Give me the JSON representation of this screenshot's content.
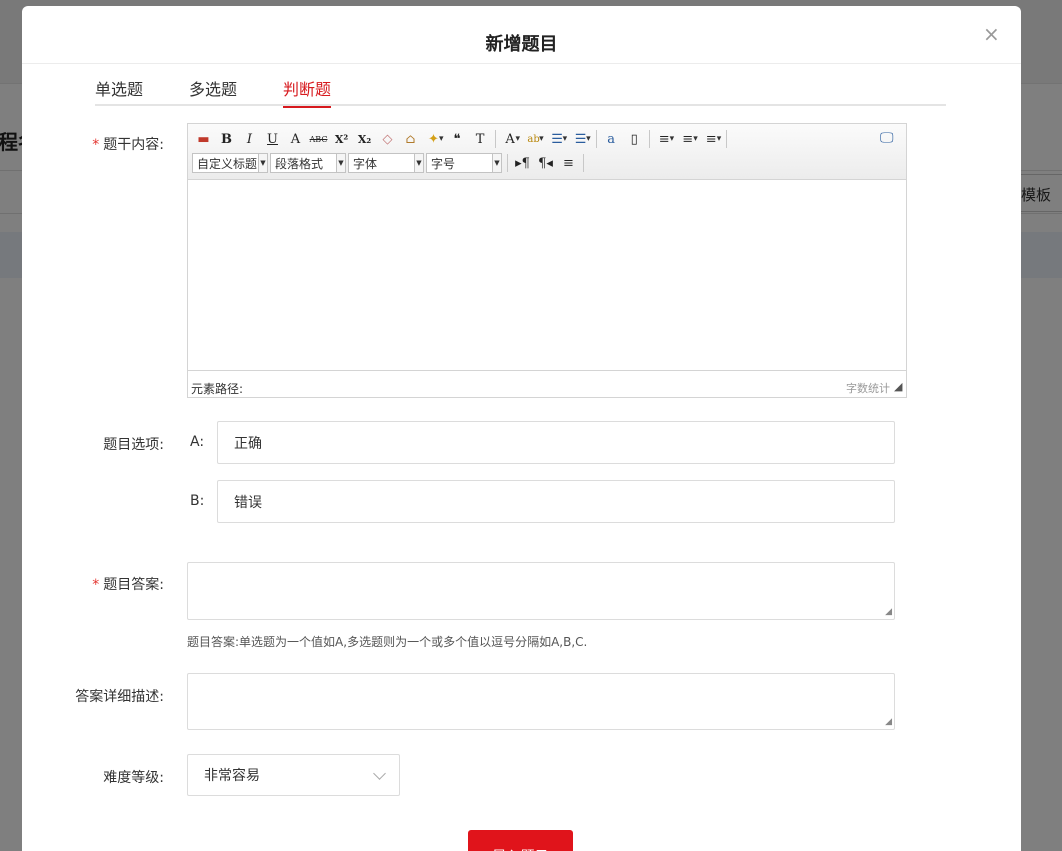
{
  "background": {
    "left_title": "程名",
    "right_button": "模板"
  },
  "modal": {
    "title": "新增题目",
    "close_label": "×"
  },
  "tabs": [
    {
      "label": "单选题",
      "active": false
    },
    {
      "label": "多选题",
      "active": false
    },
    {
      "label": "判断题",
      "active": true
    }
  ],
  "form": {
    "content_label": "题干内容:",
    "options_label": "题目选项:",
    "answer_label": "题目答案:",
    "answer_detail_label": "答案详细描述:",
    "difficulty_label": "难度等级:",
    "required_mark": "*",
    "options": [
      {
        "letter": "A:",
        "value": "正确"
      },
      {
        "letter": "B:",
        "value": "错误"
      }
    ],
    "answer_value": "",
    "answer_hint": "题目答案:单选题为一个值如A,多选题则为一个或多个值以逗号分隔如A,B,C.",
    "answer_detail_value": "",
    "difficulty_selected": "非常容易",
    "import_button": "导入题目"
  },
  "editor": {
    "toolbar_row1": [
      {
        "icon": "image-icon",
        "glyph": "▬"
      },
      {
        "icon": "bold-icon",
        "glyph": "B"
      },
      {
        "icon": "italic-icon",
        "glyph": "I"
      },
      {
        "icon": "underline-icon",
        "glyph": "U"
      },
      {
        "icon": "font-border-icon",
        "glyph": "A"
      },
      {
        "icon": "strikethrough-icon",
        "glyph": "ABC"
      },
      {
        "icon": "superscript-icon",
        "glyph": "X²"
      },
      {
        "icon": "subscript-icon",
        "glyph": "X₂"
      },
      {
        "icon": "eraser-icon",
        "glyph": "◇"
      },
      {
        "icon": "format-brush-icon",
        "glyph": "⌂"
      },
      {
        "icon": "magic-wand-icon",
        "glyph": "✦"
      },
      {
        "icon": "blockquote-icon",
        "glyph": "❝"
      },
      {
        "icon": "paste-plain-icon",
        "glyph": "T"
      },
      {
        "icon": "font-color-icon",
        "glyph": "A"
      },
      {
        "icon": "highlight-icon",
        "glyph": "ab"
      },
      {
        "icon": "ordered-list-icon",
        "glyph": "☰"
      },
      {
        "icon": "unordered-list-icon",
        "glyph": "☰"
      },
      {
        "icon": "select-all-icon",
        "glyph": "a"
      },
      {
        "icon": "clear-doc-icon",
        "glyph": "▯"
      },
      {
        "icon": "row-spacing-top-icon",
        "glyph": "≡"
      },
      {
        "icon": "row-spacing-bottom-icon",
        "glyph": "≡"
      },
      {
        "icon": "line-height-icon",
        "glyph": "≡"
      }
    ],
    "custom_title": "自定义标题",
    "paragraph_format": "段落格式",
    "font_family": "字体",
    "font_size": "字号",
    "toolbar_row2_icons": [
      {
        "icon": "ltr-direction-icon",
        "glyph": "▸¶"
      },
      {
        "icon": "rtl-direction-icon",
        "glyph": "¶◂"
      },
      {
        "icon": "indent-icon",
        "glyph": "≡"
      }
    ],
    "fullscreen_glyph": "🖵",
    "status_path": "元素路径:",
    "word_count": "字数统计",
    "resize_glyph": "◢"
  },
  "colors": {
    "accent": "#d7191e",
    "button_bg": "#e0141b",
    "required": "#e3342f"
  }
}
